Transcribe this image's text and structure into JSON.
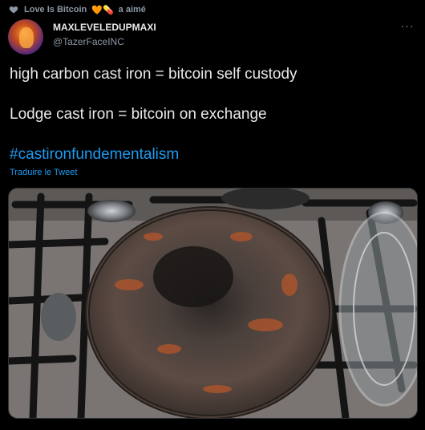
{
  "social_context": {
    "heart_icon": "heart-icon",
    "text": "Love Is Bitcoin",
    "emojis": "🧡💊",
    "suffix": "a aimé"
  },
  "tweet": {
    "author": {
      "display_name": "MAXLEVELEDUPMAXI",
      "handle": "@TazerFaceINC"
    },
    "more_label": "···",
    "lines": [
      "high carbon cast iron = bitcoin self custody",
      "Lodge cast iron = bitcoin on exchange"
    ],
    "hashtag": "#castironfundementalism",
    "translate_label": "Traduire le Tweet"
  },
  "colors": {
    "background": "#000000",
    "text": "#e7e9ea",
    "secondary": "#8b98a5",
    "link": "#1d9bf0"
  }
}
